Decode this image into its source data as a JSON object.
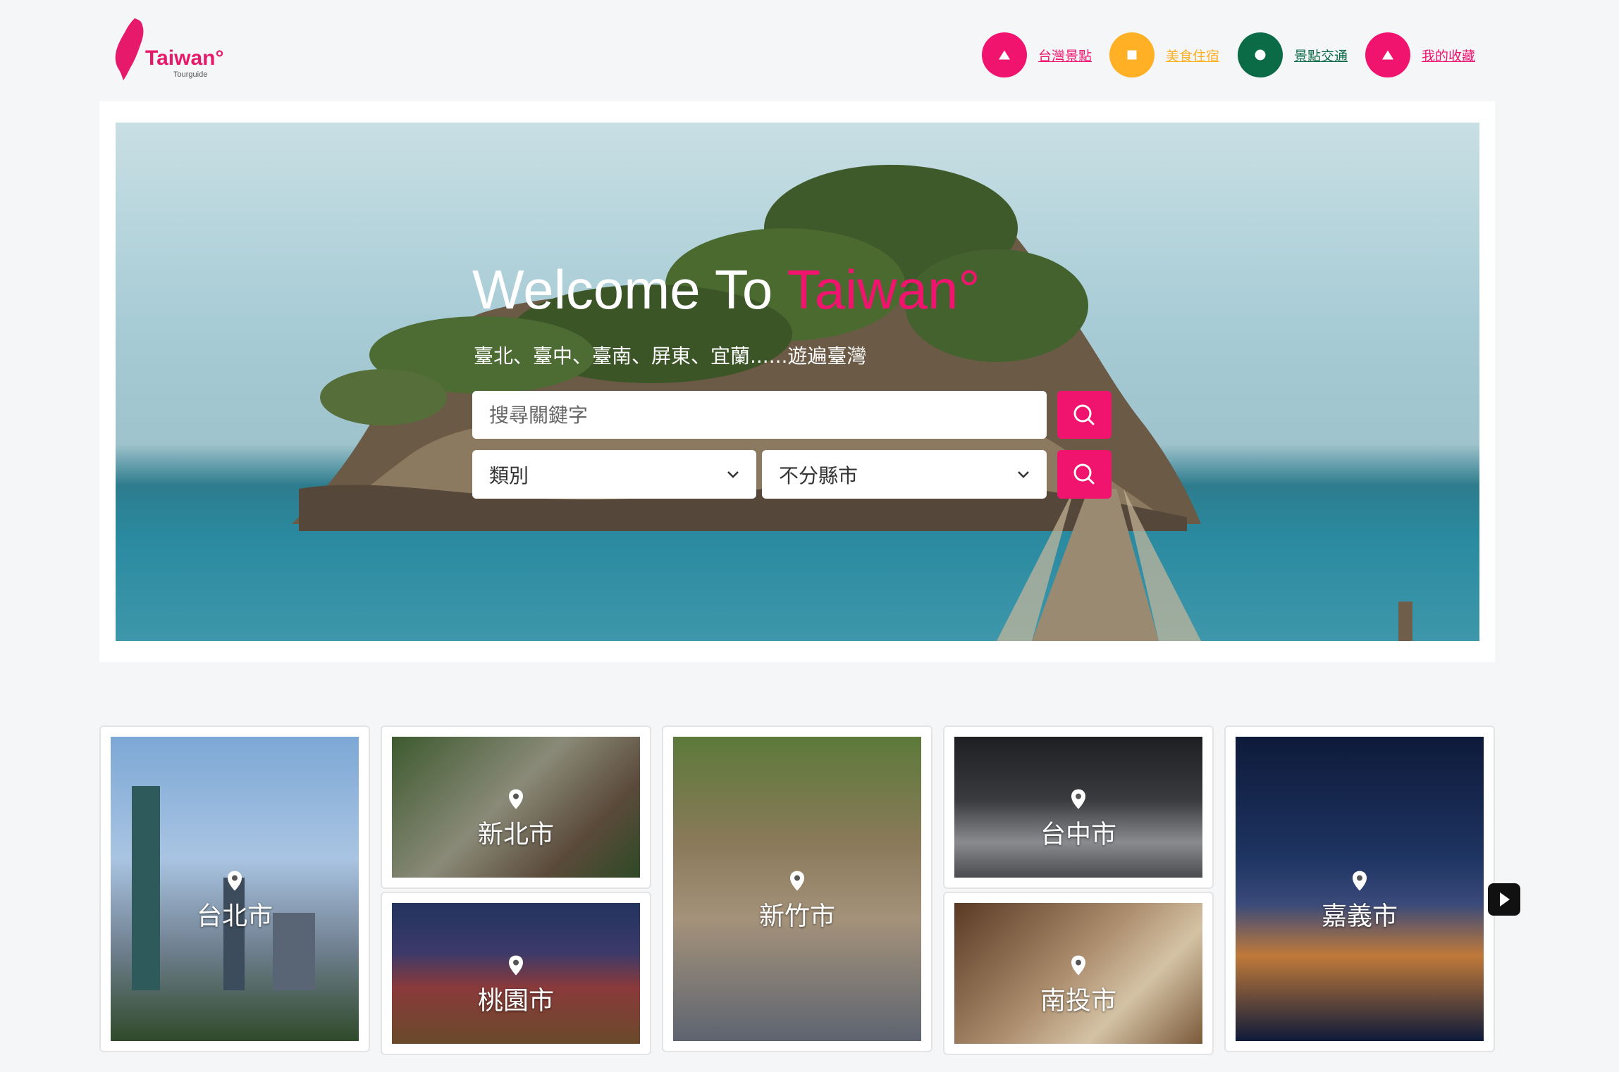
{
  "brand": {
    "name": "Taiwan°",
    "sub": "Tourguide",
    "color": "#e6196a"
  },
  "nav": [
    {
      "label": "台灣景點",
      "icon": "triangle-icon",
      "color": "#f0146e"
    },
    {
      "label": "美食住宿",
      "icon": "square-icon",
      "color": "#ffb024"
    },
    {
      "label": "景點交通",
      "icon": "circle-icon",
      "color": "#0b6b46"
    },
    {
      "label": "我的收藏",
      "icon": "triangle-icon",
      "color": "#f0146e"
    }
  ],
  "hero": {
    "title_prefix": "Welcome To ",
    "title_accent": "Taiwan°",
    "subtitle": "臺北、臺中、臺南、屏東、宜蘭......遊遍臺灣",
    "search_placeholder": "搜尋關鍵字",
    "category_select": "類別",
    "city_select": "不分縣市",
    "accent_color": "#f0146e"
  },
  "cities": [
    "台北市",
    "新北市",
    "桃園市",
    "新竹市",
    "台中市",
    "南投市",
    "嘉義市"
  ]
}
